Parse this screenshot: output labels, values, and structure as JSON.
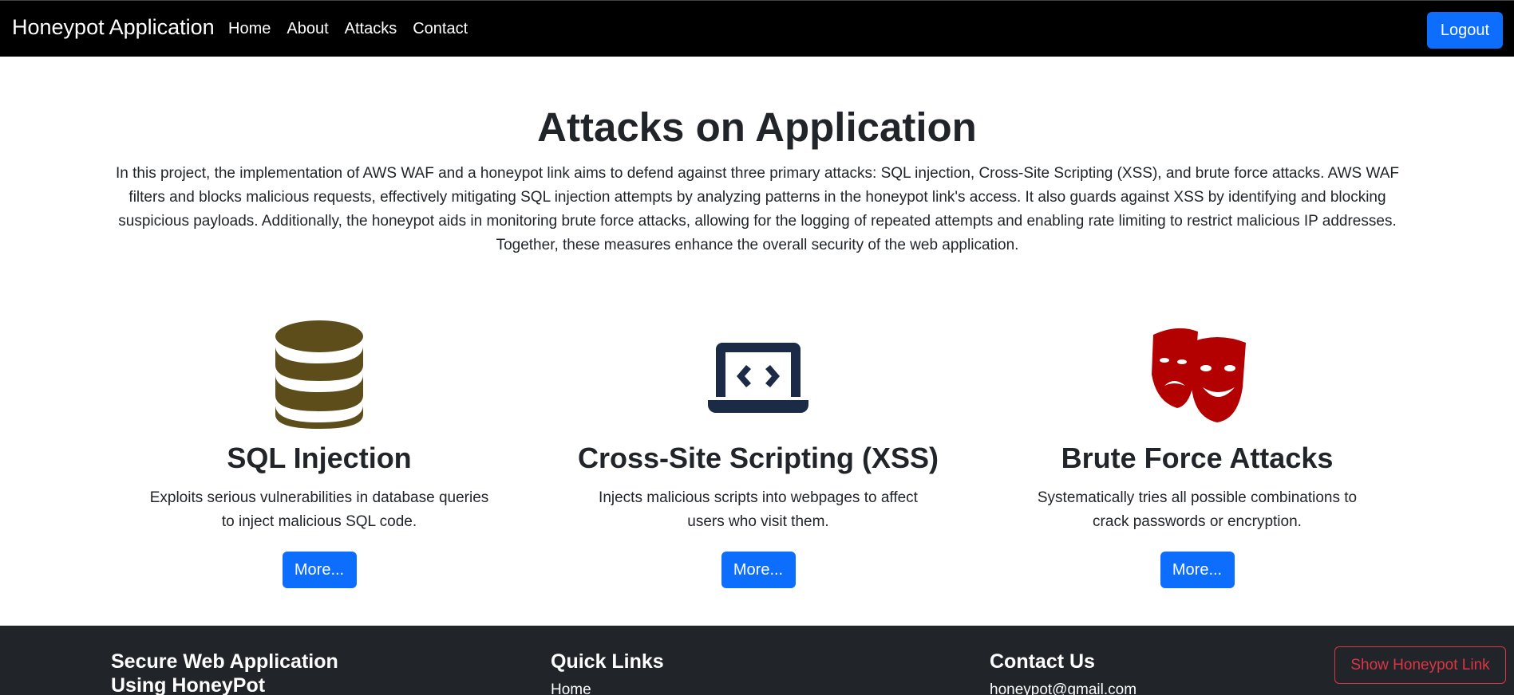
{
  "navbar": {
    "brand": "Honeypot Application",
    "links": [
      "Home",
      "About",
      "Attacks",
      "Contact"
    ],
    "logout": "Logout"
  },
  "hero": {
    "title": "Attacks on Application",
    "text": "In this project, the implementation of AWS WAF and a honeypot link aims to defend against three primary attacks: SQL injection, Cross-Site Scripting (XSS), and brute force attacks. AWS WAF filters and blocks malicious requests, effectively mitigating SQL injection attempts by analyzing patterns in the honeypot link's access. It also guards against XSS by identifying and blocking suspicious payloads. Additionally, the honeypot aids in monitoring brute force attacks, allowing for the logging of repeated attempts and enabling rate limiting to restrict malicious IP addresses. Together, these measures enhance the overall security of the web application."
  },
  "features": [
    {
      "icon": "database-icon",
      "color": "#5c4d1b",
      "title": "SQL Injection",
      "description": "Exploits serious vulnerabilities in database queries to inject malicious SQL code.",
      "button": "More..."
    },
    {
      "icon": "laptop-code-icon",
      "color": "#1b2a47",
      "title": "Cross-Site Scripting (XSS)",
      "description": "Injects malicious scripts into webpages to affect users who visit them.",
      "button": "More..."
    },
    {
      "icon": "theater-masks-icon",
      "color": "#b30000",
      "title": "Brute Force Attacks",
      "description": "Systematically tries all possible combinations to crack passwords or encryption.",
      "button": "More..."
    }
  ],
  "footer": {
    "col1_title": "Secure Web Application Using HoneyPot",
    "col2_title": "Quick Links",
    "col2_first_link": "Home",
    "col3_title": "Contact Us",
    "col3_email": "honeypot@gmail.com",
    "honeypot_button": "Show Honeypot Link"
  },
  "colors": {
    "primary": "#0d6efd",
    "danger": "#dc3545",
    "footer_bg": "#212529",
    "navbar_bg": "#000000"
  }
}
